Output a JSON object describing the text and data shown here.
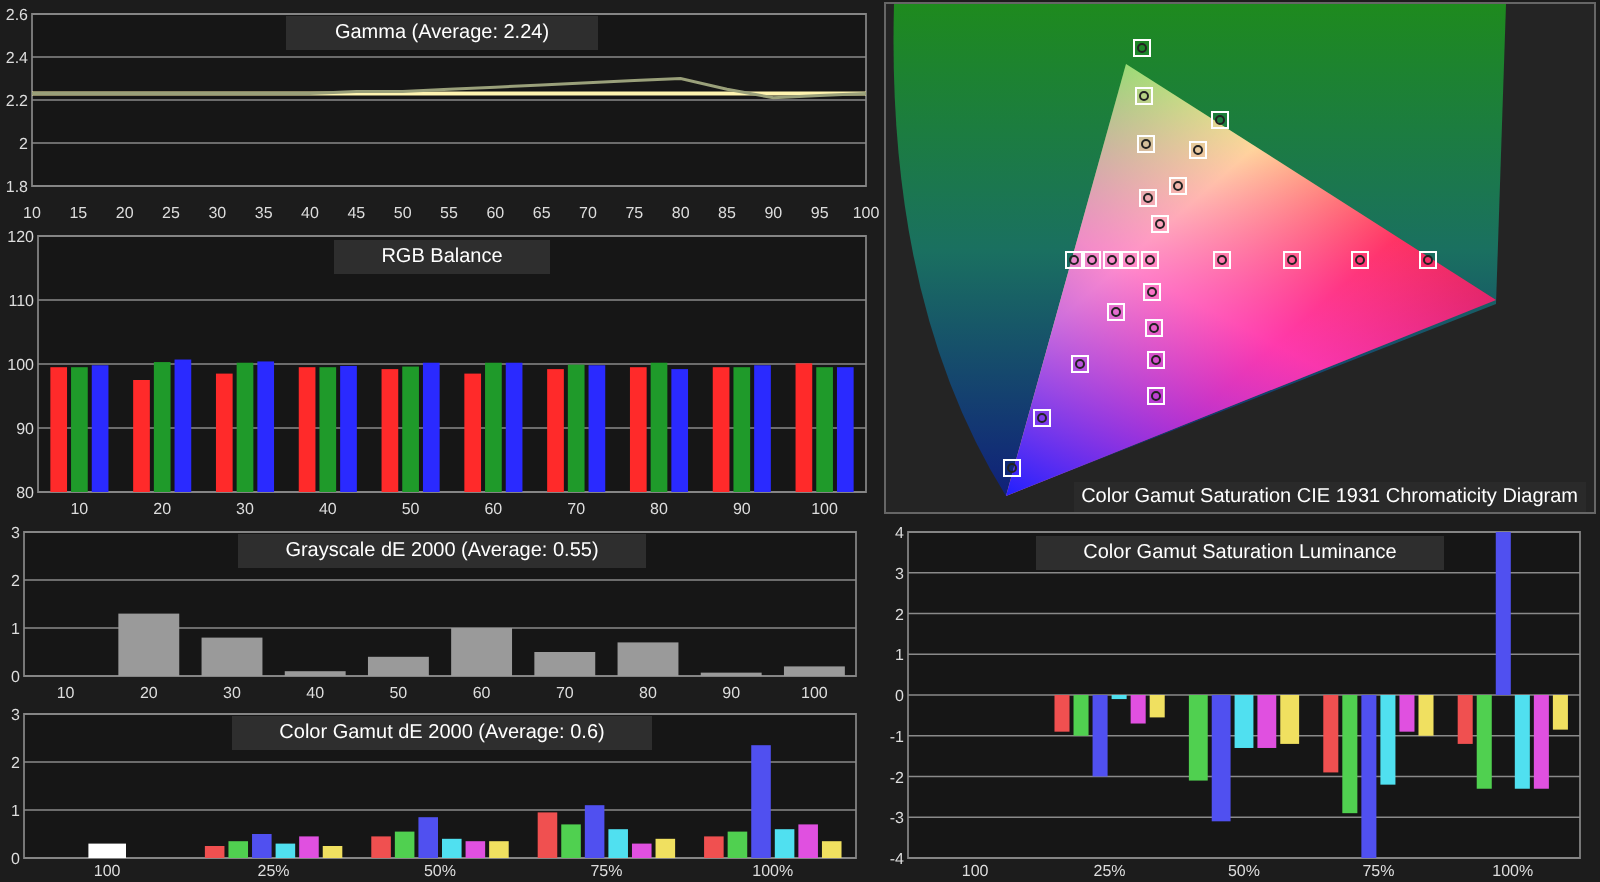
{
  "gamma": {
    "chart_data": {
      "type": "line",
      "title": "Gamma (Average: 2.24)",
      "x": [
        10,
        15,
        20,
        25,
        30,
        35,
        40,
        45,
        50,
        55,
        60,
        65,
        70,
        75,
        80,
        85,
        90,
        95,
        100
      ],
      "xticks": [
        10,
        15,
        20,
        25,
        30,
        35,
        40,
        45,
        50,
        55,
        60,
        65,
        70,
        75,
        80,
        85,
        90,
        95,
        100
      ],
      "xlim": [
        10,
        100
      ],
      "grid": true,
      "ylim": [
        1.8,
        2.6
      ],
      "yticks": [
        1.8,
        2,
        2.2,
        2.4,
        2.6
      ],
      "series": [
        {
          "color": "#fff4b0",
          "values": [
            2.23,
            2.23,
            2.23,
            2.23,
            2.23,
            2.23,
            2.23,
            2.23,
            2.23,
            2.23,
            2.23,
            2.23,
            2.23,
            2.23,
            2.23,
            2.23,
            2.23,
            2.23,
            2.23
          ]
        },
        {
          "color": "#9aa07a",
          "values": [
            2.23,
            2.23,
            2.23,
            2.23,
            2.23,
            2.23,
            2.23,
            2.24,
            2.24,
            2.25,
            2.26,
            2.27,
            2.28,
            2.29,
            2.3,
            2.25,
            2.21,
            2.22,
            2.23
          ]
        }
      ]
    }
  },
  "rgb_balance": {
    "chart_data": {
      "type": "bar",
      "title": "RGB Balance",
      "categories": [
        "10",
        "20",
        "30",
        "40",
        "50",
        "60",
        "70",
        "80",
        "90",
        "100"
      ],
      "grid": true,
      "ylim": [
        80,
        120
      ],
      "yticks": [
        80,
        90,
        100,
        110,
        120
      ],
      "series": [
        {
          "color": "#ff2a2a",
          "values": [
            99.5,
            97.5,
            98.5,
            99.5,
            99.2,
            98.5,
            99.2,
            99.5,
            99.5,
            100.1
          ]
        },
        {
          "color": "#1f9a2a",
          "values": [
            99.5,
            100.3,
            100.2,
            99.5,
            99.6,
            100.2,
            99.9,
            100.2,
            99.5,
            99.5
          ]
        },
        {
          "color": "#2a2aff",
          "values": [
            99.8,
            100.7,
            100.4,
            99.7,
            100.2,
            100.2,
            99.8,
            99.2,
            99.8,
            99.5
          ]
        }
      ]
    }
  },
  "grayscale_de": {
    "chart_data": {
      "type": "bar",
      "title": "Grayscale dE 2000 (Average: 0.55)",
      "categories": [
        "10",
        "20",
        "30",
        "40",
        "50",
        "60",
        "70",
        "80",
        "90",
        "100"
      ],
      "grid": true,
      "ylim": [
        0,
        3
      ],
      "yticks": [
        0,
        1,
        2,
        3
      ],
      "series": [
        {
          "color": "#9a9a9a",
          "values": [
            null,
            1.3,
            0.8,
            0.1,
            0.4,
            1.0,
            0.5,
            0.7,
            0.07,
            0.2
          ]
        }
      ]
    }
  },
  "color_gamut_de": {
    "chart_data": {
      "type": "bar",
      "title": "Color Gamut dE 2000 (Average: 0.6)",
      "categories": [
        "100",
        "25%",
        "50%",
        "75%",
        "100%"
      ],
      "grid": true,
      "ylim": [
        0,
        3
      ],
      "yticks": [
        0,
        1,
        2,
        3
      ],
      "series": [
        {
          "color": "#ffffff",
          "values": [
            0.3,
            null,
            null,
            null,
            null
          ]
        },
        {
          "color": "#f05050",
          "values": [
            null,
            0.25,
            0.45,
            0.95,
            0.45
          ]
        },
        {
          "color": "#50d050",
          "values": [
            null,
            0.35,
            0.55,
            0.7,
            0.55
          ]
        },
        {
          "color": "#5050f0",
          "values": [
            null,
            0.5,
            0.85,
            1.1,
            2.35
          ]
        },
        {
          "color": "#50e0f0",
          "values": [
            null,
            0.3,
            0.4,
            0.6,
            0.6
          ]
        },
        {
          "color": "#e050e0",
          "values": [
            null,
            0.45,
            0.35,
            0.3,
            0.7
          ]
        },
        {
          "color": "#f0e060",
          "values": [
            null,
            0.25,
            0.35,
            0.4,
            0.35
          ]
        }
      ]
    }
  },
  "cie_diagram": {
    "title": "Color Gamut Saturation CIE 1931 Chromaticity Diagram"
  },
  "luminance": {
    "chart_data": {
      "type": "bar",
      "title": "Color Gamut Saturation Luminance",
      "categories": [
        "100",
        "25%",
        "50%",
        "75%",
        "100%"
      ],
      "grid": true,
      "ylim": [
        -4,
        4
      ],
      "yticks": [
        -4,
        -3,
        -2,
        -1,
        0,
        1,
        2,
        3,
        4
      ],
      "series": [
        {
          "color": "#f05050",
          "values": [
            null,
            -0.9,
            null,
            -1.9,
            -1.2
          ]
        },
        {
          "color": "#50d050",
          "values": [
            null,
            -1.0,
            -2.1,
            -2.9,
            -2.3
          ]
        },
        {
          "color": "#5050f0",
          "values": [
            null,
            -2.0,
            -3.1,
            -4,
            4
          ]
        },
        {
          "color": "#50e0f0",
          "values": [
            null,
            -0.1,
            -1.3,
            -2.2,
            -2.3
          ]
        },
        {
          "color": "#e050e0",
          "values": [
            null,
            -0.7,
            -1.3,
            -0.9,
            -2.3
          ]
        },
        {
          "color": "#f0e060",
          "values": [
            null,
            -0.55,
            -1.2,
            -1.0,
            -0.85
          ]
        }
      ]
    }
  }
}
